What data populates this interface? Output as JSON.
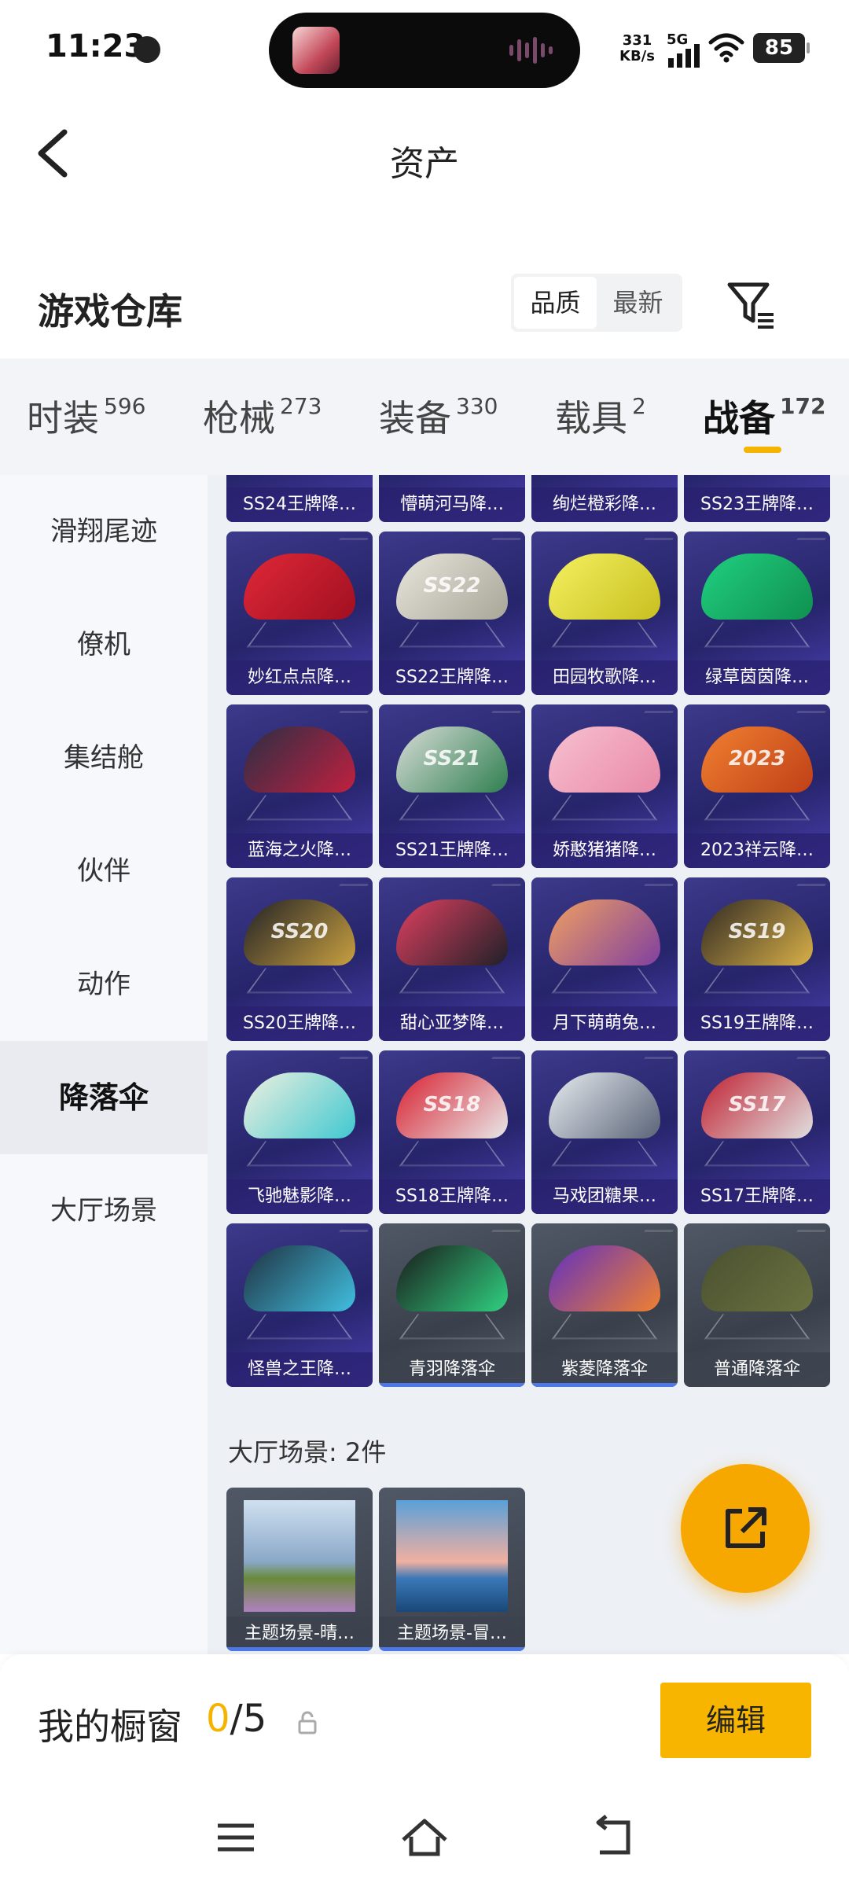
{
  "status_bar": {
    "time": "11:23",
    "net_speed_top": "331",
    "net_speed_unit": "KB/s",
    "signal": "5G",
    "battery": "85"
  },
  "header": {
    "title": "资产"
  },
  "warehouse": {
    "title": "游戏仓库",
    "sort_options": [
      "品质",
      "最新"
    ],
    "active_sort": "品质"
  },
  "tabs": [
    {
      "label": "时装",
      "count": "596"
    },
    {
      "label": "枪械",
      "count": "273"
    },
    {
      "label": "装备",
      "count": "330"
    },
    {
      "label": "载具",
      "count": "2"
    },
    {
      "label": "战备",
      "count": "172"
    }
  ],
  "active_tab": "战备",
  "sidebar": {
    "items": [
      "滑翔尾迹",
      "僚机",
      "集结舱",
      "伙伴",
      "动作",
      "降落伞",
      "大厅场景"
    ],
    "active": "降落伞"
  },
  "parachutes": [
    {
      "label": "SS24王牌降…",
      "tint": "#3c3a8a",
      "chute": [
        "#2c2c3c",
        "#6a6a8a"
      ]
    },
    {
      "label": "懵萌河马降…",
      "tint": "#3c3a8a",
      "chute": [
        "#d8d8e8",
        "#9a9ab8"
      ]
    },
    {
      "label": "绚烂橙彩降…",
      "tint": "#3c3a8a",
      "chute": [
        "#b04080",
        "#6a2a6a"
      ]
    },
    {
      "label": "SS23王牌降…",
      "tint": "#3c3a8a",
      "chute": [
        "#b03040",
        "#6a2030"
      ]
    },
    {
      "label": "妙红点点降…",
      "tint": "#3c3a8a",
      "chute": [
        "#e02838",
        "#a01020"
      ]
    },
    {
      "label": "SS22王牌降…",
      "tint": "#3c3a8a",
      "chute": [
        "#e8e6dc",
        "#a8a698"
      ],
      "text": "SS22"
    },
    {
      "label": "田园牧歌降…",
      "tint": "#3c3a8a",
      "chute": [
        "#f4f060",
        "#c8c020"
      ]
    },
    {
      "label": "绿草茵茵降…",
      "tint": "#3c3a8a",
      "chute": [
        "#20d080",
        "#109050"
      ]
    },
    {
      "label": "蓝海之火降…",
      "tint": "#3c3a8a",
      "chute": [
        "#2a2e44",
        "#c02040"
      ]
    },
    {
      "label": "SS21王牌降…",
      "tint": "#3c3a8a",
      "chute": [
        "#d8dcd8",
        "#308050"
      ],
      "text": "SS21"
    },
    {
      "label": "娇憨猪猪降…",
      "tint": "#3c3a8a",
      "chute": [
        "#f8c0d0",
        "#e88aa8"
      ]
    },
    {
      "label": "2023祥云降…",
      "tint": "#3c3a8a",
      "chute": [
        "#f08030",
        "#c04018"
      ],
      "text": "2023"
    },
    {
      "label": "SS20王牌降…",
      "tint": "#3c3a8a",
      "chute": [
        "#222226",
        "#c8a040"
      ],
      "text": "SS20"
    },
    {
      "label": "甜心亚梦降…",
      "tint": "#3c3a8a",
      "chute": [
        "#e04060",
        "#202028"
      ]
    },
    {
      "label": "月下萌萌兔…",
      "tint": "#3c3a8a",
      "chute": [
        "#f0a060",
        "#8040a0"
      ]
    },
    {
      "label": "SS19王牌降…",
      "tint": "#3c3a8a",
      "chute": [
        "#302a24",
        "#d8b048"
      ],
      "text": "SS19"
    },
    {
      "label": "飞驰魅影降…",
      "tint": "#3c3a8a",
      "chute": [
        "#f0f0e0",
        "#40c8d0"
      ]
    },
    {
      "label": "SS18王牌降…",
      "tint": "#3c3a8a",
      "chute": [
        "#d82030",
        "#e8e8e8"
      ],
      "text": "SS18"
    },
    {
      "label": "马戏团糖果…",
      "tint": "#3c3a8a",
      "chute": [
        "#e8ecf0",
        "#5a6478"
      ]
    },
    {
      "label": "SS17王牌降…",
      "tint": "#3c3a8a",
      "chute": [
        "#c02030",
        "#e0e0e0"
      ],
      "text": "SS17"
    },
    {
      "label": "怪兽之王降…",
      "tint": "#3c3a8a",
      "chute": [
        "#203040",
        "#40c0e0"
      ]
    },
    {
      "label": "青羽降落伞",
      "tint": "gray",
      "chute": [
        "#1a1a1a",
        "#30d080"
      ]
    },
    {
      "label": "紫菱降落伞",
      "tint": "gray",
      "chute": [
        "#6030c0",
        "#f08030"
      ]
    },
    {
      "label": "普通降落伞",
      "tint": "gray",
      "chute": [
        "#4a5030",
        "#6a7240"
      ]
    }
  ],
  "gray_bars": [
    21,
    22
  ],
  "scenes_section": {
    "title": "大厅场景: 2件"
  },
  "scenes": [
    {
      "label": "主题场景-晴…",
      "sky": [
        "#cfe0f0",
        "#8aa8c8"
      ],
      "ground": [
        "#6a8a3a",
        "#b080c0"
      ]
    },
    {
      "label": "主题场景-冒…",
      "sky": [
        "#5aa0d8",
        "#f0b0a0"
      ],
      "ground": [
        "#3a78b8",
        "#1a4878"
      ]
    }
  ],
  "showcase": {
    "label": "我的橱窗",
    "current": "0",
    "total": "/5",
    "edit_label": "编辑"
  },
  "colors": {
    "accent": "#f5b400",
    "card_purple": "#3c3a8a",
    "card_gray": "#4a505c",
    "bar_blue": "#4d78e8"
  }
}
